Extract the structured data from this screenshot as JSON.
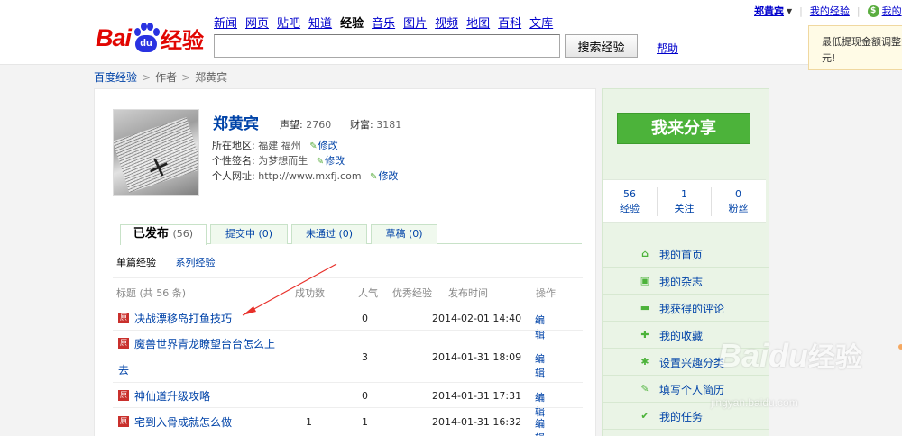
{
  "header": {
    "logo": {
      "bai": "Bai",
      "du": "du",
      "jingyan": "经验"
    },
    "nav": [
      "新闻",
      "网页",
      "贴吧",
      "知道",
      "经验",
      "音乐",
      "图片",
      "视频",
      "地图",
      "百科",
      "文库"
    ],
    "nav_active_index": 4,
    "search_value": "",
    "search_button": "搜索经验",
    "help": "帮助",
    "user": "郑黄宾",
    "my_jingyan": "我的经验",
    "my_cut": "我的",
    "tip_line1": "最低提现金额调整为",
    "tip_line2": "元!"
  },
  "breadcrumb": [
    "百度经验",
    "作者",
    "郑黄宾"
  ],
  "profile": {
    "name": "郑黄宾",
    "prestige_label": "声望:",
    "prestige": "2760",
    "wealth_label": "财富:",
    "wealth": "3181",
    "location_label": "所在地区:",
    "location": "福建 福州",
    "signature_label": "个性签名:",
    "signature": "为梦想而生",
    "website_label": "个人网址:",
    "website": "http://www.mxfj.com",
    "edit": "修改"
  },
  "tabs": [
    {
      "label": "已发布",
      "count": "(56)"
    },
    {
      "label": "提交中",
      "count": "(0)"
    },
    {
      "label": "未通过",
      "count": "(0)"
    },
    {
      "label": "草稿",
      "count": "(0)"
    }
  ],
  "subtabs": [
    "单篇经验",
    "系列经验"
  ],
  "table": {
    "headers": [
      "标题 (共 56 条)",
      "成功数",
      "人气",
      "优秀经验",
      "发布时间",
      "操作"
    ],
    "tag": "原",
    "rows": [
      {
        "title": "决战漂移岛打鱼技巧",
        "success": "",
        "pop": "0",
        "time": "2014-02-01 14:40",
        "op": "编辑"
      },
      {
        "title": "魔兽世界青龙瞭望台台怎么上",
        "title2": "去",
        "success": "",
        "pop": "3",
        "time": "2014-01-31 18:09",
        "op": "编辑"
      },
      {
        "title": "神仙道升级攻略",
        "success": "",
        "pop": "0",
        "time": "2014-01-31 17:31",
        "op": "编辑"
      },
      {
        "title": "宅到入骨成就怎么做",
        "success": "1",
        "pop": "1",
        "time": "2014-01-31 16:32",
        "op": "编辑"
      }
    ]
  },
  "sidebar": {
    "share_button": "我来分享",
    "counts": [
      {
        "num": "56",
        "label": "经验"
      },
      {
        "num": "1",
        "label": "关注"
      },
      {
        "num": "0",
        "label": "粉丝"
      }
    ],
    "menu": [
      {
        "icon": "home-icon",
        "label": "我的首页"
      },
      {
        "icon": "magazine-icon",
        "label": "我的杂志"
      },
      {
        "icon": "comment-icon",
        "label": "我获得的评论"
      },
      {
        "icon": "favorite-icon",
        "label": "我的收藏"
      },
      {
        "icon": "gear-icon",
        "label": "设置兴趣分类"
      },
      {
        "icon": "edit-icon",
        "label": "填写个人简历"
      },
      {
        "icon": "task-icon",
        "label": "我的任务"
      }
    ]
  },
  "watermark": {
    "brand": "Baidu",
    "jingyan": "经验",
    "url": "jingyan.baidu.com"
  },
  "colors": {
    "accent_green": "#4cb33a",
    "link_blue": "#0043a8",
    "brand_red": "#e10602",
    "brand_blue": "#2932e1"
  }
}
